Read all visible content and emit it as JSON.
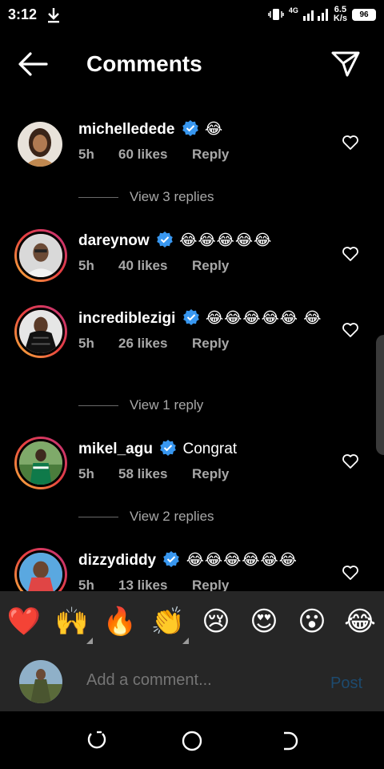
{
  "status": {
    "time": "3:12",
    "network": "4G",
    "speed_value": "6.5",
    "speed_unit": "K/s",
    "battery": "96"
  },
  "header": {
    "title": "Comments",
    "back_icon": "arrow-left-icon",
    "share_icon": "paper-plane-icon"
  },
  "comments": [
    {
      "username": "michelledede",
      "verified": true,
      "text": "😂",
      "time": "5h",
      "likes": "60 likes",
      "reply": "Reply",
      "view_replies": "View 3 replies"
    },
    {
      "username": "dareynow",
      "verified": true,
      "text": "😂😂😂😂😂",
      "time": "5h",
      "likes": "40 likes",
      "reply": "Reply"
    },
    {
      "username": "incrediblezigi",
      "verified": true,
      "text": "😂😂😂😂😂 😂",
      "time": "5h",
      "likes": "26 likes",
      "reply": "Reply",
      "view_replies": "View 1 reply"
    },
    {
      "username": "mikel_agu",
      "verified": true,
      "text": "Congrat",
      "time": "5h",
      "likes": "58 likes",
      "reply": "Reply",
      "view_replies": "View 2 replies"
    },
    {
      "username": "dizzydiddy",
      "verified": true,
      "text": "😂😂😂😂😂😂",
      "time": "5h",
      "likes": "13 likes",
      "reply": "Reply"
    }
  ],
  "emoji_bar": [
    "❤️",
    "🙌",
    "🔥",
    "👏",
    "😢",
    "😍",
    "😮",
    "😂"
  ],
  "compose": {
    "placeholder": "Add a comment...",
    "post_label": "Post"
  },
  "colors": {
    "background": "#000000",
    "muted_text": "#a8a8a8",
    "verified_blue": "#3897f0",
    "post_disabled": "#1d4a6e",
    "panel": "#262626"
  }
}
